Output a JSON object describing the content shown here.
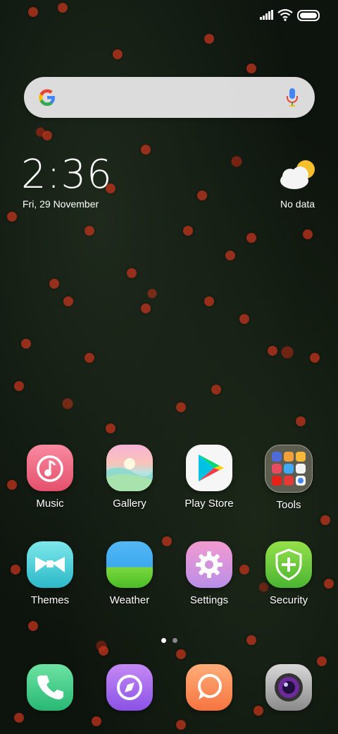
{
  "status_bar": {
    "signal": "signal-icon",
    "wifi": "wifi-icon",
    "battery": "battery-icon"
  },
  "search": {
    "logo": "google-g-icon",
    "mic": "microphone-icon"
  },
  "clock": {
    "time": "2:36",
    "date": "Fri, 29 November"
  },
  "weather_widget": {
    "icon": "partly-cloudy-icon",
    "text": "No data"
  },
  "apps": [
    {
      "label": "Music",
      "icon": "music-note-icon"
    },
    {
      "label": "Gallery",
      "icon": "gallery-sunset-icon"
    },
    {
      "label": "Play Store",
      "icon": "play-store-icon"
    },
    {
      "label": "Tools",
      "icon": "folder-grid-icon"
    },
    {
      "label": "Themes",
      "icon": "bowtie-icon"
    },
    {
      "label": "Weather",
      "icon": "weather-landscape-icon"
    },
    {
      "label": "Settings",
      "icon": "gear-icon"
    },
    {
      "label": "Security",
      "icon": "shield-plus-icon"
    }
  ],
  "dock": [
    {
      "name": "phone",
      "icon": "phone-icon"
    },
    {
      "name": "browser",
      "icon": "browser-icon"
    },
    {
      "name": "messaging",
      "icon": "chat-bubble-icon"
    },
    {
      "name": "camera",
      "icon": "camera-lens-icon"
    }
  ],
  "page_indicator": {
    "pages": 2,
    "current": 1
  },
  "colors": {
    "accent_active_dot": "#ffffff",
    "inactive_dot": "#888888"
  }
}
